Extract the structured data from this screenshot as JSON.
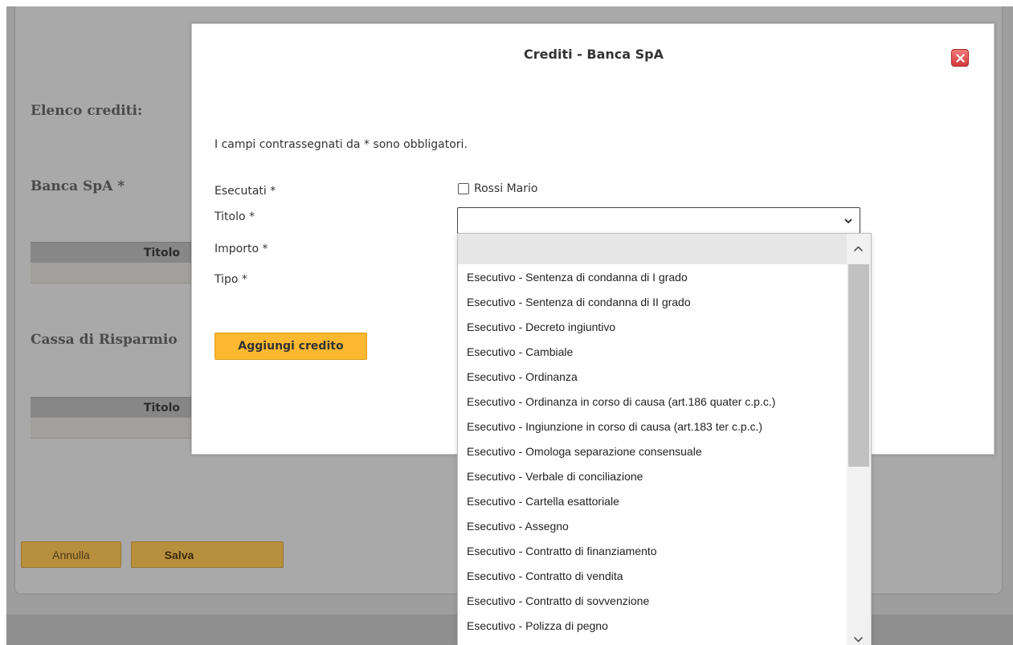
{
  "background": {
    "headings": {
      "elenco": "Elenco crediti:",
      "banca": "Banca SpA *",
      "cassa": "Cassa di Risparmio"
    },
    "table_headers": [
      "Titolo",
      "Titolo"
    ],
    "buttons": {
      "annulla": "Annulla",
      "salva": "Salva"
    }
  },
  "modal": {
    "title": "Crediti - Banca SpA",
    "close_icon": "close-x-icon",
    "note": "I campi contrassegnati da * sono obbligatori.",
    "labels": {
      "esecutati": "Esecutati *",
      "titolo": "Titolo *",
      "importo": "Importo *",
      "tipo": "Tipo *"
    },
    "esecutati_option": "Rossi Mario",
    "titolo_value": "",
    "add_button": "Aggiungi credito"
  },
  "dropdown": {
    "options": [
      "",
      "Esecutivo - Sentenza di condanna di I grado",
      "Esecutivo - Sentenza di condanna di II grado",
      "Esecutivo - Decreto ingiuntivo",
      "Esecutivo - Cambiale",
      "Esecutivo - Ordinanza",
      "Esecutivo - Ordinanza in corso di causa (art.186 quater c.p.c.)",
      "Esecutivo - Ingiunzione in corso di causa (art.183 ter c.p.c.)",
      "Esecutivo - Omologa separazione consensuale",
      "Esecutivo - Verbale di conciliazione",
      "Esecutivo - Cartella esattoriale",
      "Esecutivo - Assegno",
      "Esecutivo - Contratto di finanziamento",
      "Esecutivo - Contratto di vendita",
      "Esecutivo - Contratto di sovvenzione",
      "Esecutivo - Polizza di pegno"
    ]
  },
  "colors": {
    "accent_button": "#fcb830",
    "close_button": "#d33a3a",
    "overlay_gray": "#9e9e9e"
  }
}
